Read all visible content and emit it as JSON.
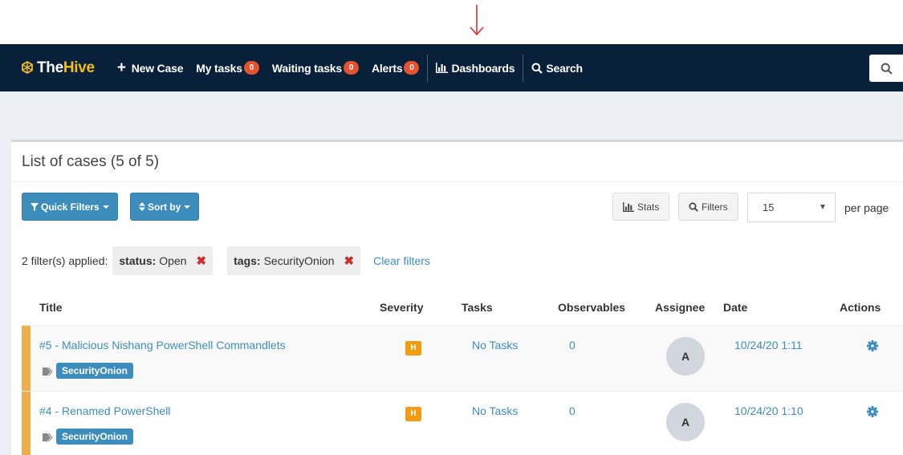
{
  "navbar": {
    "brand_part1": "The",
    "brand_part2": "Hive",
    "new_case": "New Case",
    "my_tasks": "My tasks",
    "my_tasks_count": "0",
    "waiting_tasks": "Waiting tasks",
    "waiting_tasks_count": "0",
    "alerts": "Alerts",
    "alerts_count": "0",
    "dashboards": "Dashboards",
    "search": "Search"
  },
  "panel": {
    "title": "List of cases (5 of 5)"
  },
  "toolbar": {
    "quick_filters": "Quick Filters",
    "sort_by": "Sort by",
    "stats": "Stats",
    "filters": "Filters",
    "page_size": "15",
    "per_page": "per page"
  },
  "filters": {
    "applied_label": "2 filter(s) applied:",
    "chips": [
      {
        "key": "status:",
        "value": "Open"
      },
      {
        "key": "tags:",
        "value": "SecurityOnion"
      }
    ],
    "clear": "Clear filters"
  },
  "table": {
    "columns": [
      "Title",
      "Severity",
      "Tasks",
      "Observables",
      "Assignee",
      "Date",
      "Actions"
    ],
    "rows": [
      {
        "title": "#5 - Malicious Nishang PowerShell Commandlets",
        "tag": "SecurityOnion",
        "severity": "H",
        "tasks": "No Tasks",
        "observables": "0",
        "assignee": "A",
        "date": "10/24/20 1:11"
      },
      {
        "title": "#4 - Renamed PowerShell",
        "tag": "SecurityOnion",
        "severity": "H",
        "tasks": "No Tasks",
        "observables": "0",
        "assignee": "A",
        "date": "10/24/20 1:10"
      }
    ]
  },
  "colors": {
    "navbar_bg": "#082039",
    "brand_accent": "#f3bd1e",
    "badge": "#e4522e",
    "link": "#3c8dbc",
    "severity_high": "#f39c12",
    "row_flag": "#f0ad4e",
    "annotation_arrow": "#e0302a"
  }
}
